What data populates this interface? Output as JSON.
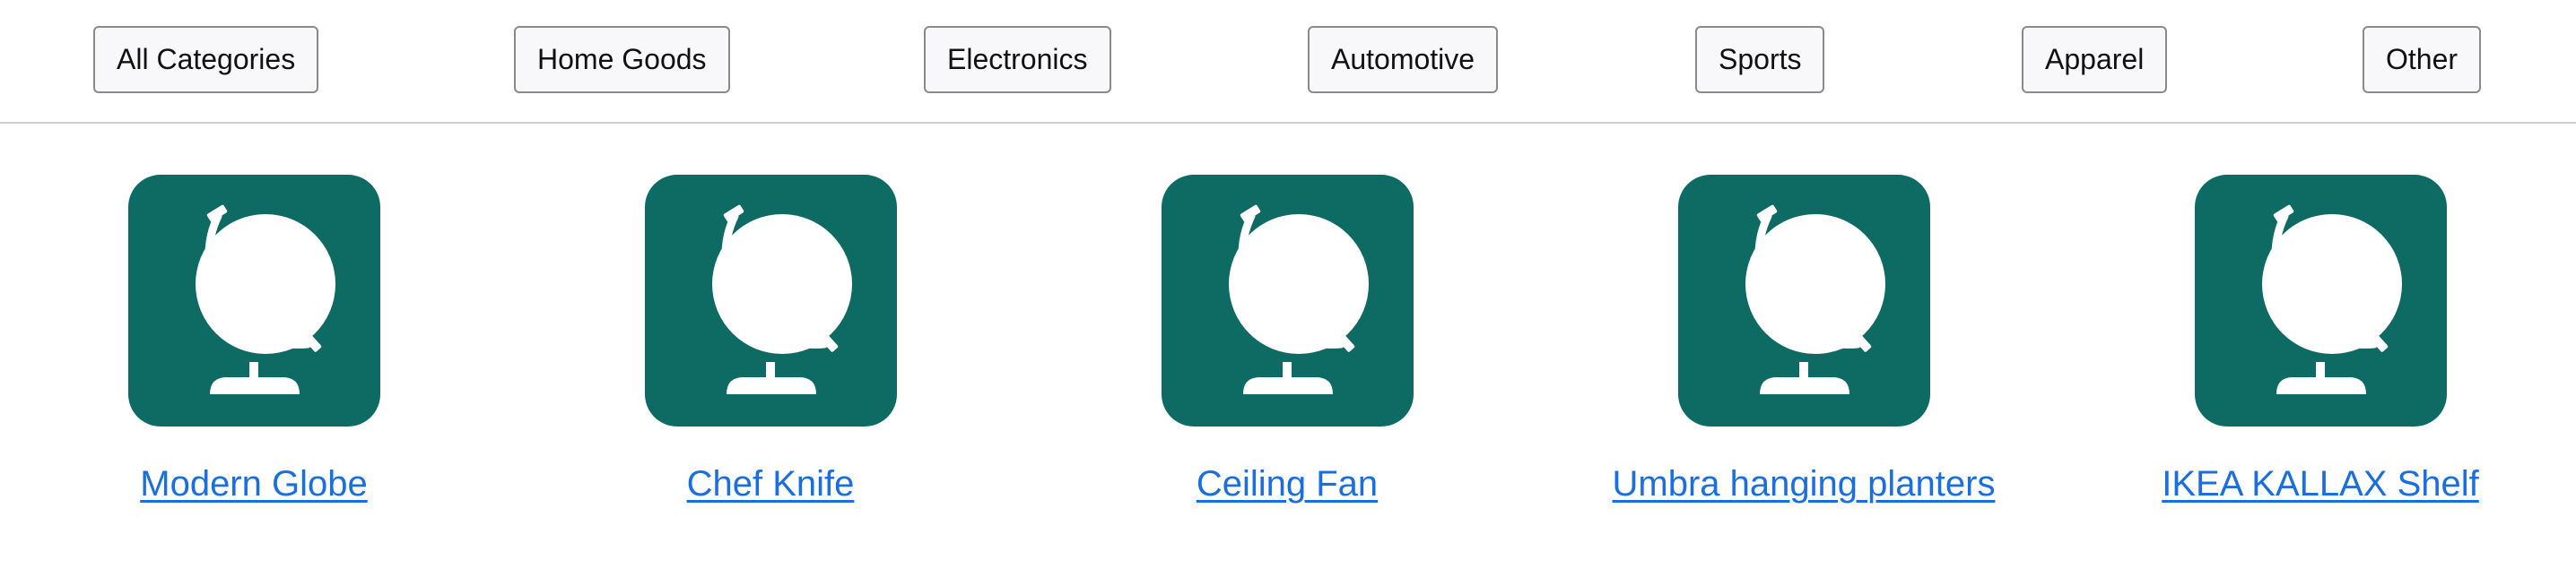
{
  "categories": {
    "buttons": [
      {
        "label": "All Categories"
      },
      {
        "label": "Home Goods"
      },
      {
        "label": "Electronics"
      },
      {
        "label": "Automotive"
      },
      {
        "label": "Sports"
      },
      {
        "label": "Apparel"
      },
      {
        "label": "Other"
      }
    ]
  },
  "products": {
    "items": [
      {
        "name": "Modern Globe",
        "icon": "globe-icon"
      },
      {
        "name": "Chef Knife",
        "icon": "globe-icon"
      },
      {
        "name": "Ceiling Fan",
        "icon": "globe-icon"
      },
      {
        "name": "Umbra hanging planters",
        "icon": "globe-icon"
      },
      {
        "name": "IKEA KALLAX Shelf",
        "icon": "globe-icon"
      }
    ]
  },
  "colors": {
    "icon_tile": "#0e6b64",
    "link": "#1a6fe0",
    "button_bg": "#f8f8fa",
    "divider": "#cfcfcf"
  }
}
